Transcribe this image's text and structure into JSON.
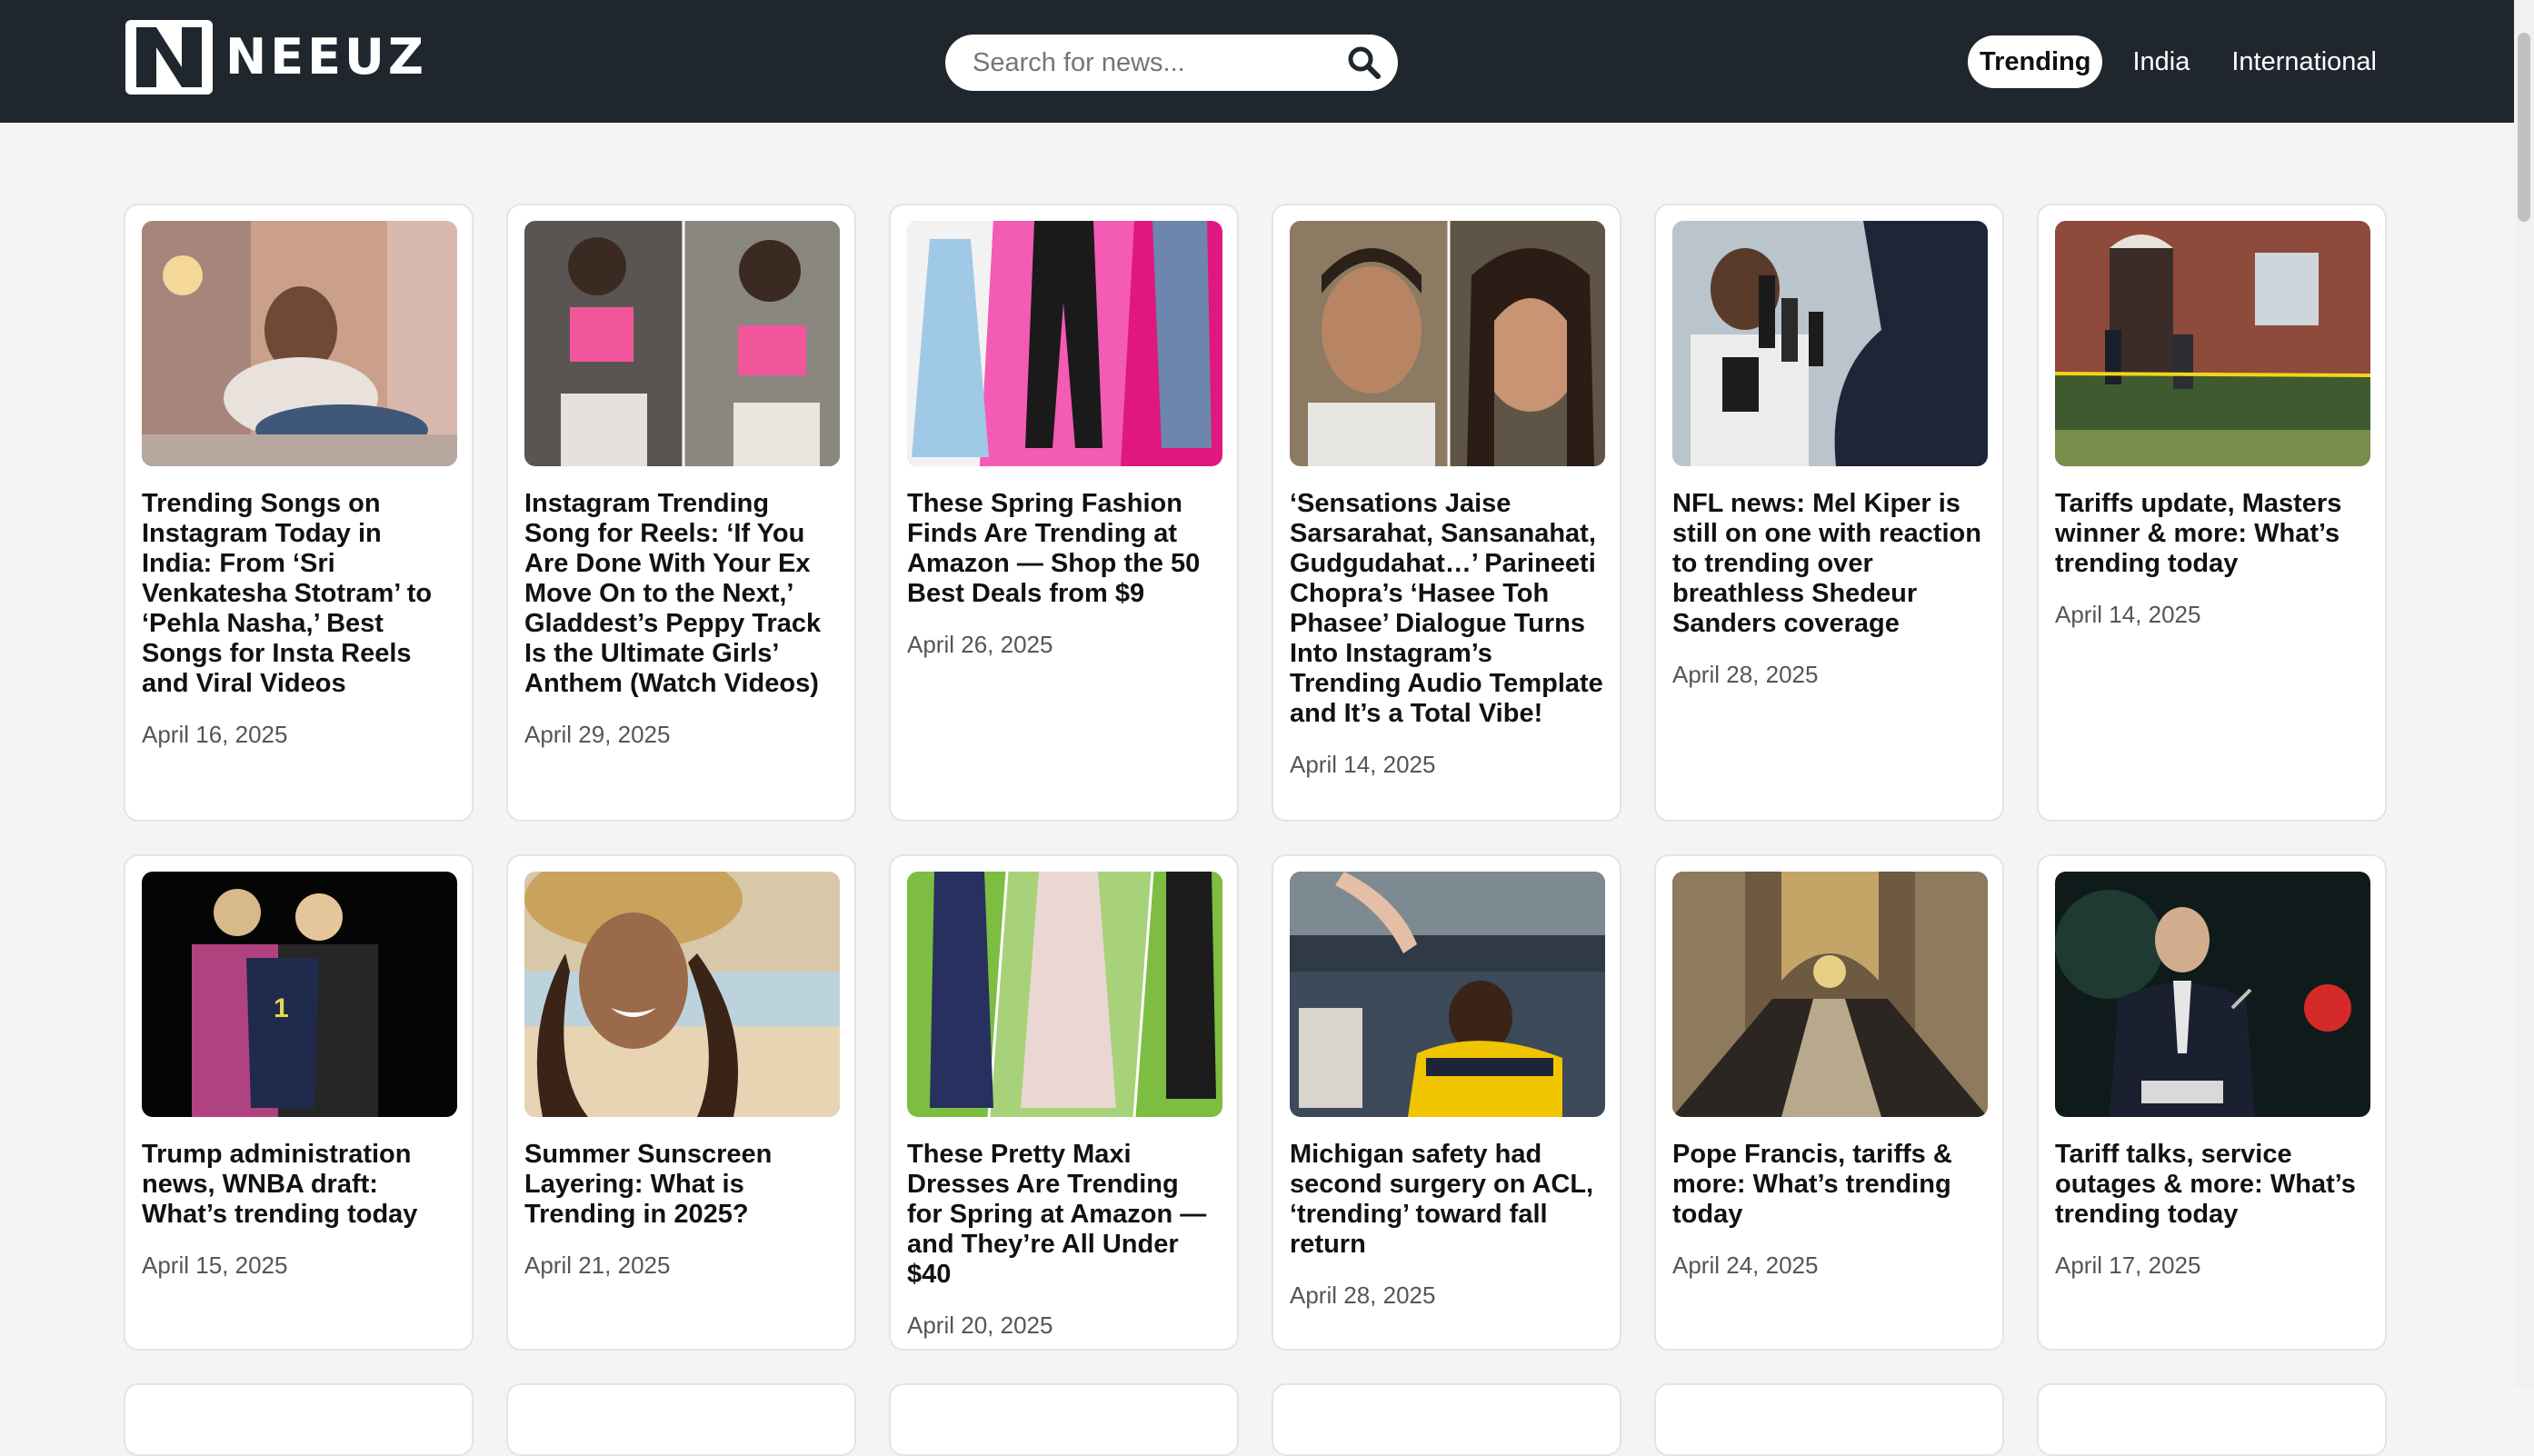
{
  "brand": {
    "name": "NEEUZ",
    "logo_letter": "N"
  },
  "search": {
    "placeholder": "Search for news...",
    "icon": "search-icon"
  },
  "nav": {
    "items": [
      {
        "label": "Trending",
        "active": true
      },
      {
        "label": "India",
        "active": false
      },
      {
        "label": "International",
        "active": false
      }
    ]
  },
  "colors": {
    "topbar": "#1f262e",
    "page_bg": "#f5f3f3",
    "card_bg": "#ffffff"
  },
  "articles": [
    {
      "title": "Trending Songs on Instagram Today in India: From ‘Sri Venkatesha Stotram’ to ‘Pehla Nasha,’ Best Songs for Insta Reels and Viral Videos",
      "date": "April 16, 2025"
    },
    {
      "title": "Instagram Trending Song for Reels: ‘If You Are Done With Your Ex Move On to the Next,’ Gladdest’s Peppy Track Is the Ultimate Girls’ Anthem (Watch Videos)",
      "date": "April 29, 2025"
    },
    {
      "title": "These Spring Fashion Finds Are Trending at Amazon — Shop the 50 Best Deals from $9",
      "date": "April 26, 2025"
    },
    {
      "title": "‘Sensations Jaise Sarsarahat, Sansanahat, Gudgudahat…’ Parineeti Chopra’s ‘Hasee Toh Phasee’ Dialogue Turns Into Instagram’s Trending Audio Template and It’s a Total Vibe!",
      "date": "April 14, 2025"
    },
    {
      "title": "NFL news: Mel Kiper is still on one with reaction to trending over breathless Shedeur Sanders coverage",
      "date": "April 28, 2025"
    },
    {
      "title": "Tariffs update, Masters winner & more: What’s trending today",
      "date": "April 14, 2025"
    },
    {
      "title": "Trump administration news, WNBA draft: What’s trending today",
      "date": "April 15, 2025"
    },
    {
      "title": "Summer Sunscreen Layering: What is Trending in 2025?",
      "date": "April 21, 2025"
    },
    {
      "title": "These Pretty Maxi Dresses Are Trending for Spring at Amazon — and They’re All Under $40",
      "date": "April 20, 2025"
    },
    {
      "title": "Michigan safety had second surgery on ACL, ‘trending’ toward fall return",
      "date": "April 28, 2025"
    },
    {
      "title": "Pope Francis, tariffs & more: What’s trending today",
      "date": "April 24, 2025"
    },
    {
      "title": "Tariff talks, service outages & more: What’s trending today",
      "date": "April 17, 2025"
    }
  ]
}
